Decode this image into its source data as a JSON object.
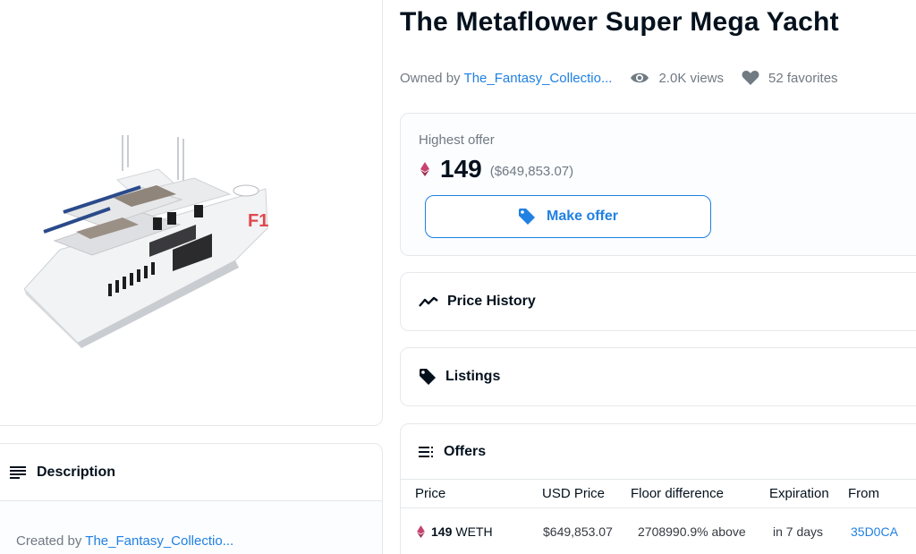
{
  "asset": {
    "title": "The Metaflower Super Mega Yacht",
    "owned_by_label": "Owned by",
    "owner": "The_Fantasy_Collectio...",
    "views": "2.0K views",
    "favorites": "52 favorites",
    "hull_marking": "F1"
  },
  "offer_panel": {
    "label": "Highest offer",
    "amount": "149",
    "usd": "($649,853.07)",
    "button_label": "Make offer"
  },
  "sections": {
    "price_history": "Price History",
    "listings": "Listings",
    "offers": "Offers"
  },
  "offers_table": {
    "columns": [
      "Price",
      "USD Price",
      "Floor difference",
      "Expiration",
      "From"
    ],
    "rows": [
      {
        "amount": "149",
        "currency": "WETH",
        "usd": "$649,853.07",
        "floor_difference": "2708990.9% above",
        "expiration": "in 7 days",
        "from": "35D0CA"
      }
    ]
  },
  "description": {
    "title": "Description",
    "created_by_label": "Created by",
    "creator": "The_Fantasy_Collectio..."
  },
  "icons": {
    "views": "eye-icon",
    "favorites": "heart-icon",
    "currency": "eth-icon",
    "make_offer": "tag-icon",
    "price_history": "trend-line-icon",
    "listings": "tag-icon",
    "offers": "list-icon",
    "description": "text-lines-icon"
  },
  "colors": {
    "link": "#2081e2",
    "text": "#04111d",
    "muted": "#707a83",
    "border": "#e5e8eb",
    "eth": "#c6446e"
  }
}
